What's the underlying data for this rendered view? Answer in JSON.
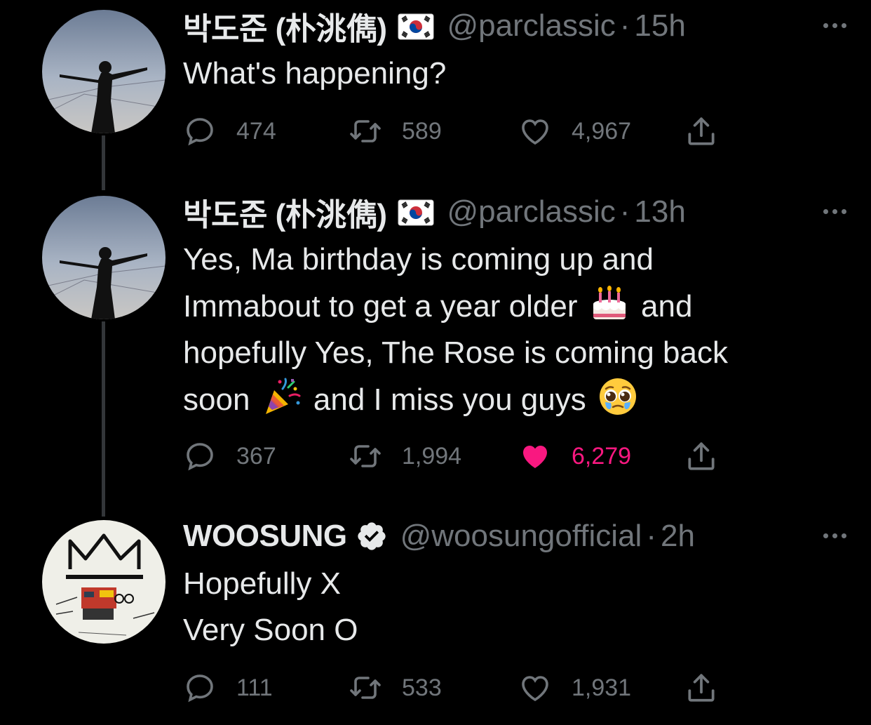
{
  "tweets": [
    {
      "name": "박도준 (朴洮儁)",
      "flag": "south-korea-flag",
      "handle": "@parclassic",
      "dot": "·",
      "time": "15h",
      "lines": [
        "What's happening?"
      ],
      "replies": "474",
      "retweets": "589",
      "likes": "4,967",
      "liked": false
    },
    {
      "name": "박도준 (朴洮儁)",
      "flag": "south-korea-flag",
      "handle": "@parclassic",
      "dot": "·",
      "time": "13h",
      "lines": [
        "Yes, Ma birthday is coming up and",
        "Immabout to get a year older",
        "and",
        "hopefully Yes, The Rose is coming back",
        "soon",
        "and I miss you guys"
      ],
      "emojis": [
        "birthday-cake-emoji",
        "party-popper-emoji",
        "pleading-face-emoji"
      ],
      "replies": "367",
      "retweets": "1,994",
      "likes": "6,279",
      "liked": true
    },
    {
      "name": "WOOSUNG",
      "verified": true,
      "handle": "@woosungofficial",
      "dot": "·",
      "time": "2h",
      "lines": [
        "Hopefully X",
        "Very Soon O"
      ],
      "replies": "111",
      "retweets": "533",
      "likes": "1,931",
      "liked": false
    }
  ],
  "colors": {
    "background": "#000000",
    "text": "#e7e9ea",
    "muted": "#71767b",
    "like": "#f91880",
    "thread_line": "#333639"
  }
}
